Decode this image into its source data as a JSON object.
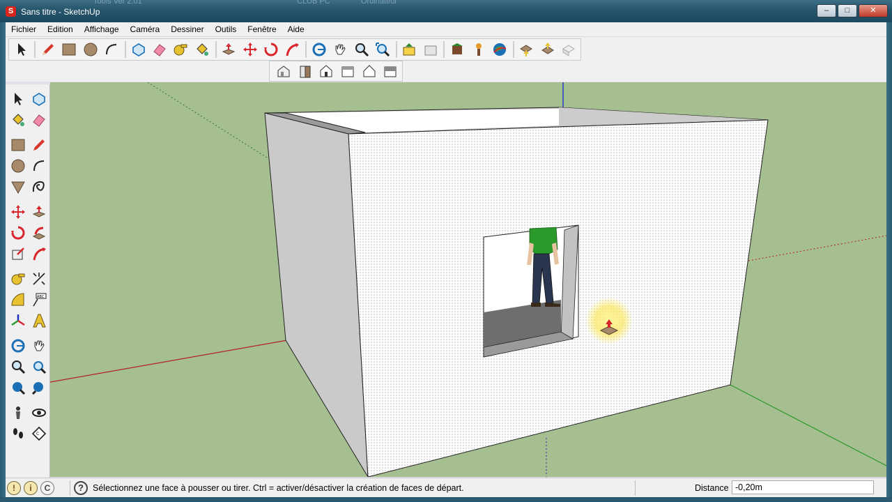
{
  "window": {
    "title": "Sans titre - SketchUp",
    "background_text": [
      "Tools Ver 2.01",
      "CLUB PC",
      "Ordinateur"
    ],
    "buttons": [
      "–",
      "□",
      "✕"
    ]
  },
  "menu": [
    "Fichier",
    "Edition",
    "Affichage",
    "Caméra",
    "Dessiner",
    "Outils",
    "Fenêtre",
    "Aide"
  ],
  "toolbar": {
    "main_icons": [
      "select-icon",
      "pencil-icon",
      "rectangle-icon",
      "circle-icon",
      "arc-icon",
      "make-component-icon",
      "eraser-icon",
      "tape-measure-icon",
      "paint-bucket-icon",
      "push-pull-icon",
      "move-icon",
      "rotate-icon",
      "follow-me-icon",
      "orbit-icon",
      "pan-icon",
      "zoom-icon",
      "zoom-extents-icon",
      "previous-view-icon",
      "next-view-icon",
      "get-models-icon",
      "place-model-icon",
      "google-earth-icon",
      "get-photo-texture-icon",
      "share-model-icon",
      "preview-earth-icon"
    ],
    "view_icons": [
      "iso-view-icon",
      "top-view-icon",
      "front-view-icon",
      "right-view-icon",
      "back-view-icon",
      "left-view-icon"
    ]
  },
  "statusbar": {
    "message": "Sélectionnez une face à pousser ou tirer.  Ctrl = activer/désactiver la création de faces de départ.",
    "vcb_label": "Distance",
    "vcb_value": "-0,20m"
  },
  "colors": {
    "ground": "#a6bf90",
    "face_front": "#ffffff",
    "face_shaded": "#c7c7c7",
    "axis_red": "#b02020",
    "axis_green": "#2a9a2a",
    "axis_blue": "#2030c0",
    "title_bar": "#25546b"
  }
}
